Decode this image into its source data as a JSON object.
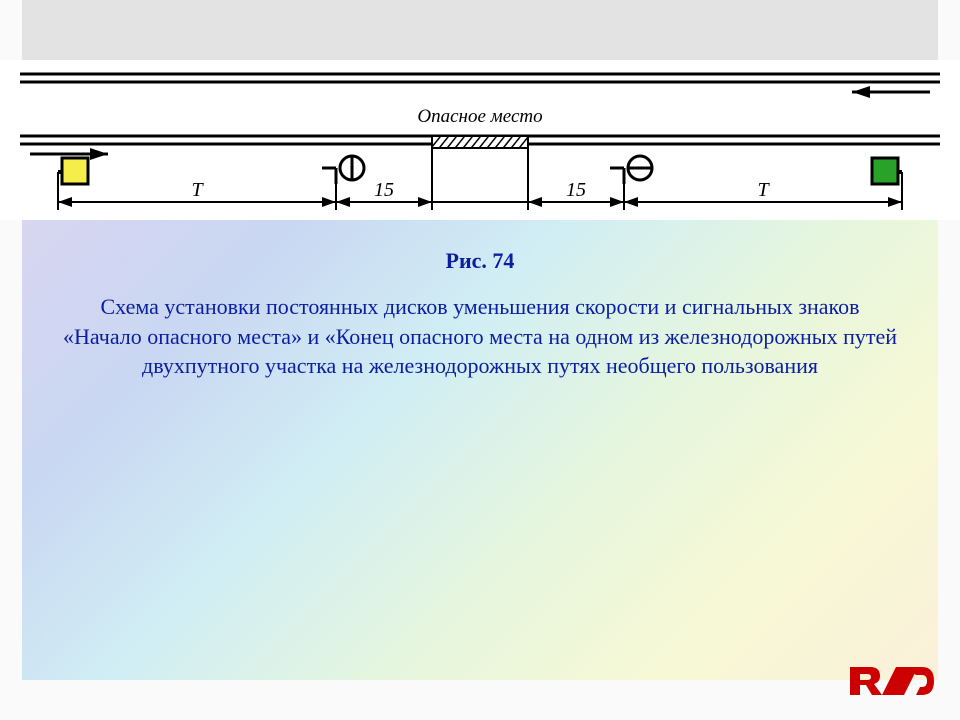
{
  "figure": {
    "title": "Рис. 74",
    "caption": "Схема установки постоянных дисков уменьшения скорости и сигнальных знаков «Начало опасного места» и «Конец опасного места на одном из железнодорожных путей двухпутного участка на железнодорожных путях необщего пользования"
  },
  "diagram": {
    "danger_label": "Опасное место",
    "dim_T": "Т",
    "dim_15_left": "15",
    "dim_15_right": "15",
    "left_sign_color": "#f4ed4a",
    "right_sign_color": "#2aa22a"
  },
  "logo_text": "РЖД"
}
